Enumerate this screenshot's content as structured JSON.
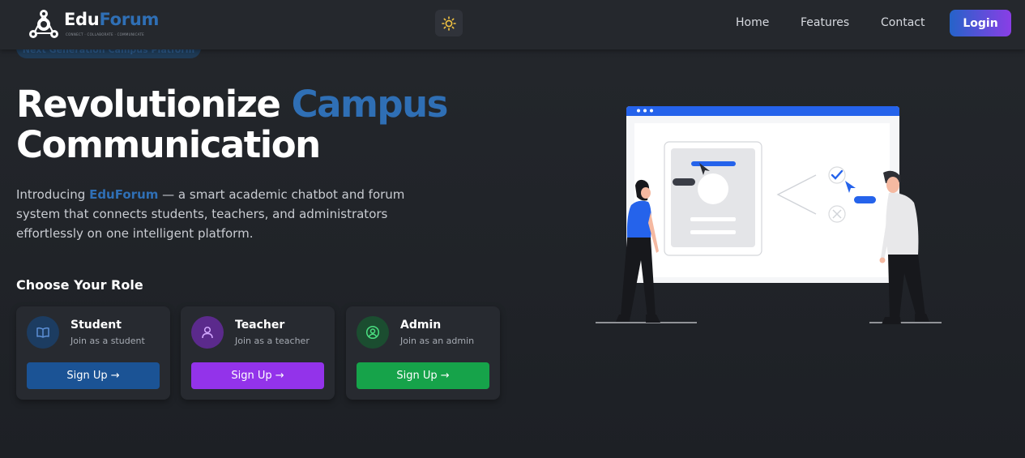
{
  "nav": {
    "logo_word_1": "Edu",
    "logo_word_2": "Forum",
    "logo_tagline": "CONNECT · COLLABORATE · COMMUNICATE",
    "links": [
      "Home",
      "Features",
      "Contact"
    ],
    "login_label": "Login"
  },
  "hero": {
    "badge": "Next Generation Campus Platform",
    "title_part_1": "Revolutionize ",
    "title_accent": "Campus",
    "title_part_2": "Communication",
    "intro_before": "Introducing ",
    "intro_brand": "EduForum",
    "intro_after": " — a smart academic chatbot and forum system that connects students, teachers, and administrators effortlessly on one intelligent platform."
  },
  "roles": {
    "heading": "Choose Your Role",
    "cards": [
      {
        "title": "Student",
        "subtitle": "Join as a student",
        "button": "Sign Up →",
        "icon": "book-icon",
        "color": "#1b5395",
        "avatar_bg": "#1c3c61"
      },
      {
        "title": "Teacher",
        "subtitle": "Join as a teacher",
        "button": "Sign Up →",
        "icon": "user-icon",
        "color": "#9333ea",
        "avatar_bg": "#5b2a8c"
      },
      {
        "title": "Admin",
        "subtitle": "Join as an admin",
        "button": "Sign Up →",
        "icon": "user-circle-icon",
        "color": "#16a34a",
        "avatar_bg": "#1b4d30"
      }
    ]
  },
  "colors": {
    "accent_blue": "#2f6fb5",
    "illustration_blue": "#2563eb"
  }
}
